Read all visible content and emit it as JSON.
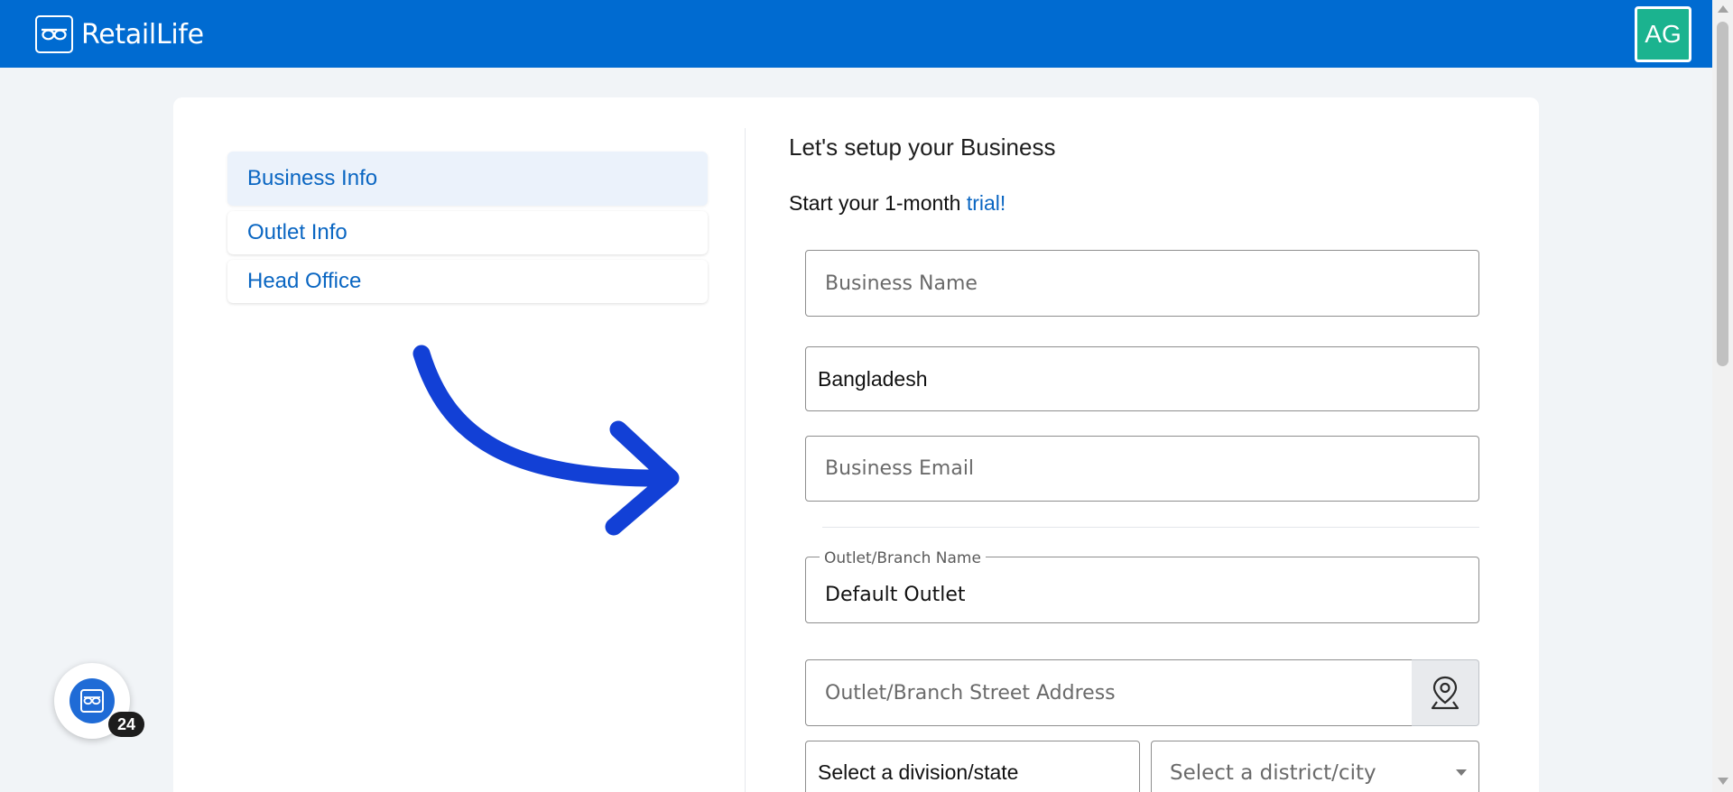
{
  "header": {
    "brand_name": "RetailLife",
    "avatar_initials": "AG"
  },
  "sidebar": {
    "items": [
      {
        "label": "Business Info",
        "active": true
      },
      {
        "label": "Outlet Info",
        "active": false
      },
      {
        "label": "Head Office",
        "active": false
      }
    ]
  },
  "form": {
    "heading": "Let's setup your Business",
    "subheading_prefix": "Start your 1-month ",
    "subheading_link": "trial!",
    "business_name": {
      "placeholder": "Business Name",
      "value": ""
    },
    "country": {
      "value": "Bangladesh"
    },
    "business_email": {
      "placeholder": "Business Email",
      "value": ""
    },
    "outlet_name": {
      "label": "Outlet/Branch Name",
      "value": "Default Outlet"
    },
    "outlet_address": {
      "placeholder": "Outlet/Branch Street Address",
      "value": ""
    },
    "division_select": {
      "selected": "Select a division/state"
    },
    "district_select": {
      "selected": "Select a district/city"
    }
  },
  "support_widget": {
    "badge_count": "24"
  },
  "icons": [
    "glasses-logo-icon",
    "curved-arrow-icon",
    "map-pin-icon",
    "chevron-down-icon"
  ],
  "colors": {
    "primary": "#006bd1",
    "avatar_bg": "#1bb38f",
    "link": "#0a66c2",
    "arrow": "#1240d6",
    "page_bg": "#f1f4f7"
  }
}
